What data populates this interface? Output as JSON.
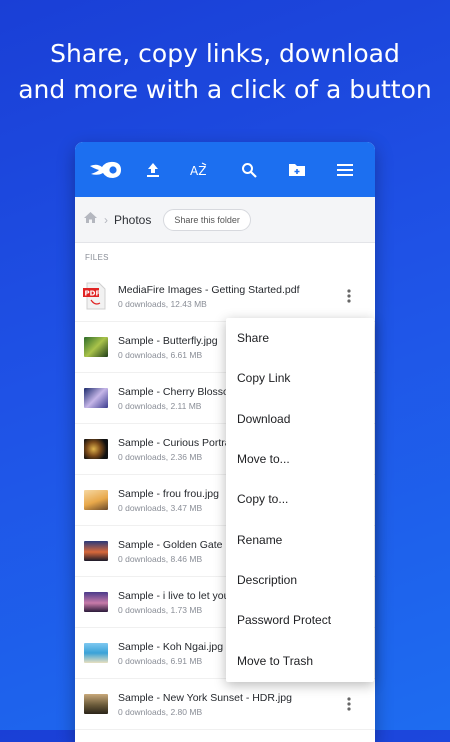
{
  "headline": {
    "line1": "Share, copy links, download",
    "line2": "and more with a click of a button"
  },
  "toolbar": {
    "icons": [
      "mediafire-logo-icon",
      "upload-icon",
      "sort-az-icon",
      "search-icon",
      "new-folder-icon",
      "menu-icon"
    ],
    "accent": "#1c6ff0"
  },
  "breadcrumb": {
    "current": "Photos",
    "share_button": "Share this folder"
  },
  "files_section_label": "FILES",
  "files": [
    {
      "name": "MediaFire Images - Getting Started.pdf",
      "meta": "0 downloads, 12.43 MB"
    },
    {
      "name": "Sample - Butterfly.jpg",
      "meta": "0 downloads, 6.61 MB"
    },
    {
      "name": "Sample - Cherry Blossom",
      "meta": "0 downloads, 2.11 MB"
    },
    {
      "name": "Sample - Curious Portrai",
      "meta": "0 downloads, 2.36 MB"
    },
    {
      "name": "Sample - frou frou.jpg",
      "meta": "0 downloads, 3.47 MB"
    },
    {
      "name": "Sample - Golden Gate Hi",
      "meta": "0 downloads, 8.46 MB"
    },
    {
      "name": "Sample - i live to let you",
      "meta": "0 downloads, 1.73 MB"
    },
    {
      "name": "Sample - Koh Ngai.jpg",
      "meta": "0 downloads, 6.91 MB"
    },
    {
      "name": "Sample - New York Sunset - HDR.jpg",
      "meta": "0 downloads, 2.80 MB"
    }
  ],
  "context_menu": [
    "Share",
    "Copy Link",
    "Download",
    "Move to...",
    "Copy to...",
    "Rename",
    "Description",
    "Password Protect",
    "Move to Trash"
  ]
}
